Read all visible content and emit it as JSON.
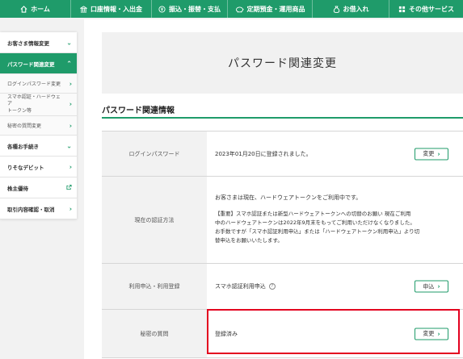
{
  "topnav": {
    "items": [
      {
        "label": "ホーム",
        "icon": "home-icon"
      },
      {
        "label": "口座情報・入出金",
        "icon": "building-icon"
      },
      {
        "label": "振込・振替・支払",
        "icon": "yen-icon"
      },
      {
        "label": "定期預金・運用商品",
        "icon": "piggy-bank-icon"
      },
      {
        "label": "お借入れ",
        "icon": "money-bag-icon"
      },
      {
        "label": "その他サービス",
        "icon": "grid-icon"
      }
    ]
  },
  "sidebar": {
    "items": [
      {
        "label": "お客さま情報変更"
      },
      {
        "label": "パスワード関連変更"
      },
      {
        "label": "ログインパスワード変更"
      },
      {
        "label_line1": "スマホ認証・ハードウェア",
        "label_line2": "トークン等"
      },
      {
        "label": "秘密の質問変更"
      },
      {
        "label": "各種お手続き"
      },
      {
        "label": "りそなデビット"
      },
      {
        "label": "株主優待"
      },
      {
        "label": "取引内容確認・取消"
      }
    ]
  },
  "page": {
    "title": "パスワード関連変更",
    "section_title": "パスワード関連情報"
  },
  "table": {
    "rows": [
      {
        "label": "ログインパスワード",
        "value": "2023年01月20日に登録されました。",
        "button": "変更"
      },
      {
        "label": "現在の認証方法",
        "lead": "お客さまは現在、ハードウェアトークンをご利用中です。",
        "lines": [
          "【重要】スマホ認証または新型ハードウェアトークンへの切替のお願い 現在ご利用",
          "中のハードウェアトークンは2022年9月末をもってご利用いただけなくなりました。",
          "お手数ですが「スマホ認証利用申込」または「ハードウェアトークン利用申込」より切",
          "替申込をお願いいたします。"
        ]
      },
      {
        "label": "利用申込・利用登録",
        "value": "スマホ認証利用申込",
        "help": "?",
        "button": "申込"
      },
      {
        "label": "秘密の質問",
        "value": "登録済み",
        "button": "変更"
      }
    ]
  },
  "colors": {
    "brand_green": "#1f9b6a",
    "highlight_red": "#e3001f"
  }
}
